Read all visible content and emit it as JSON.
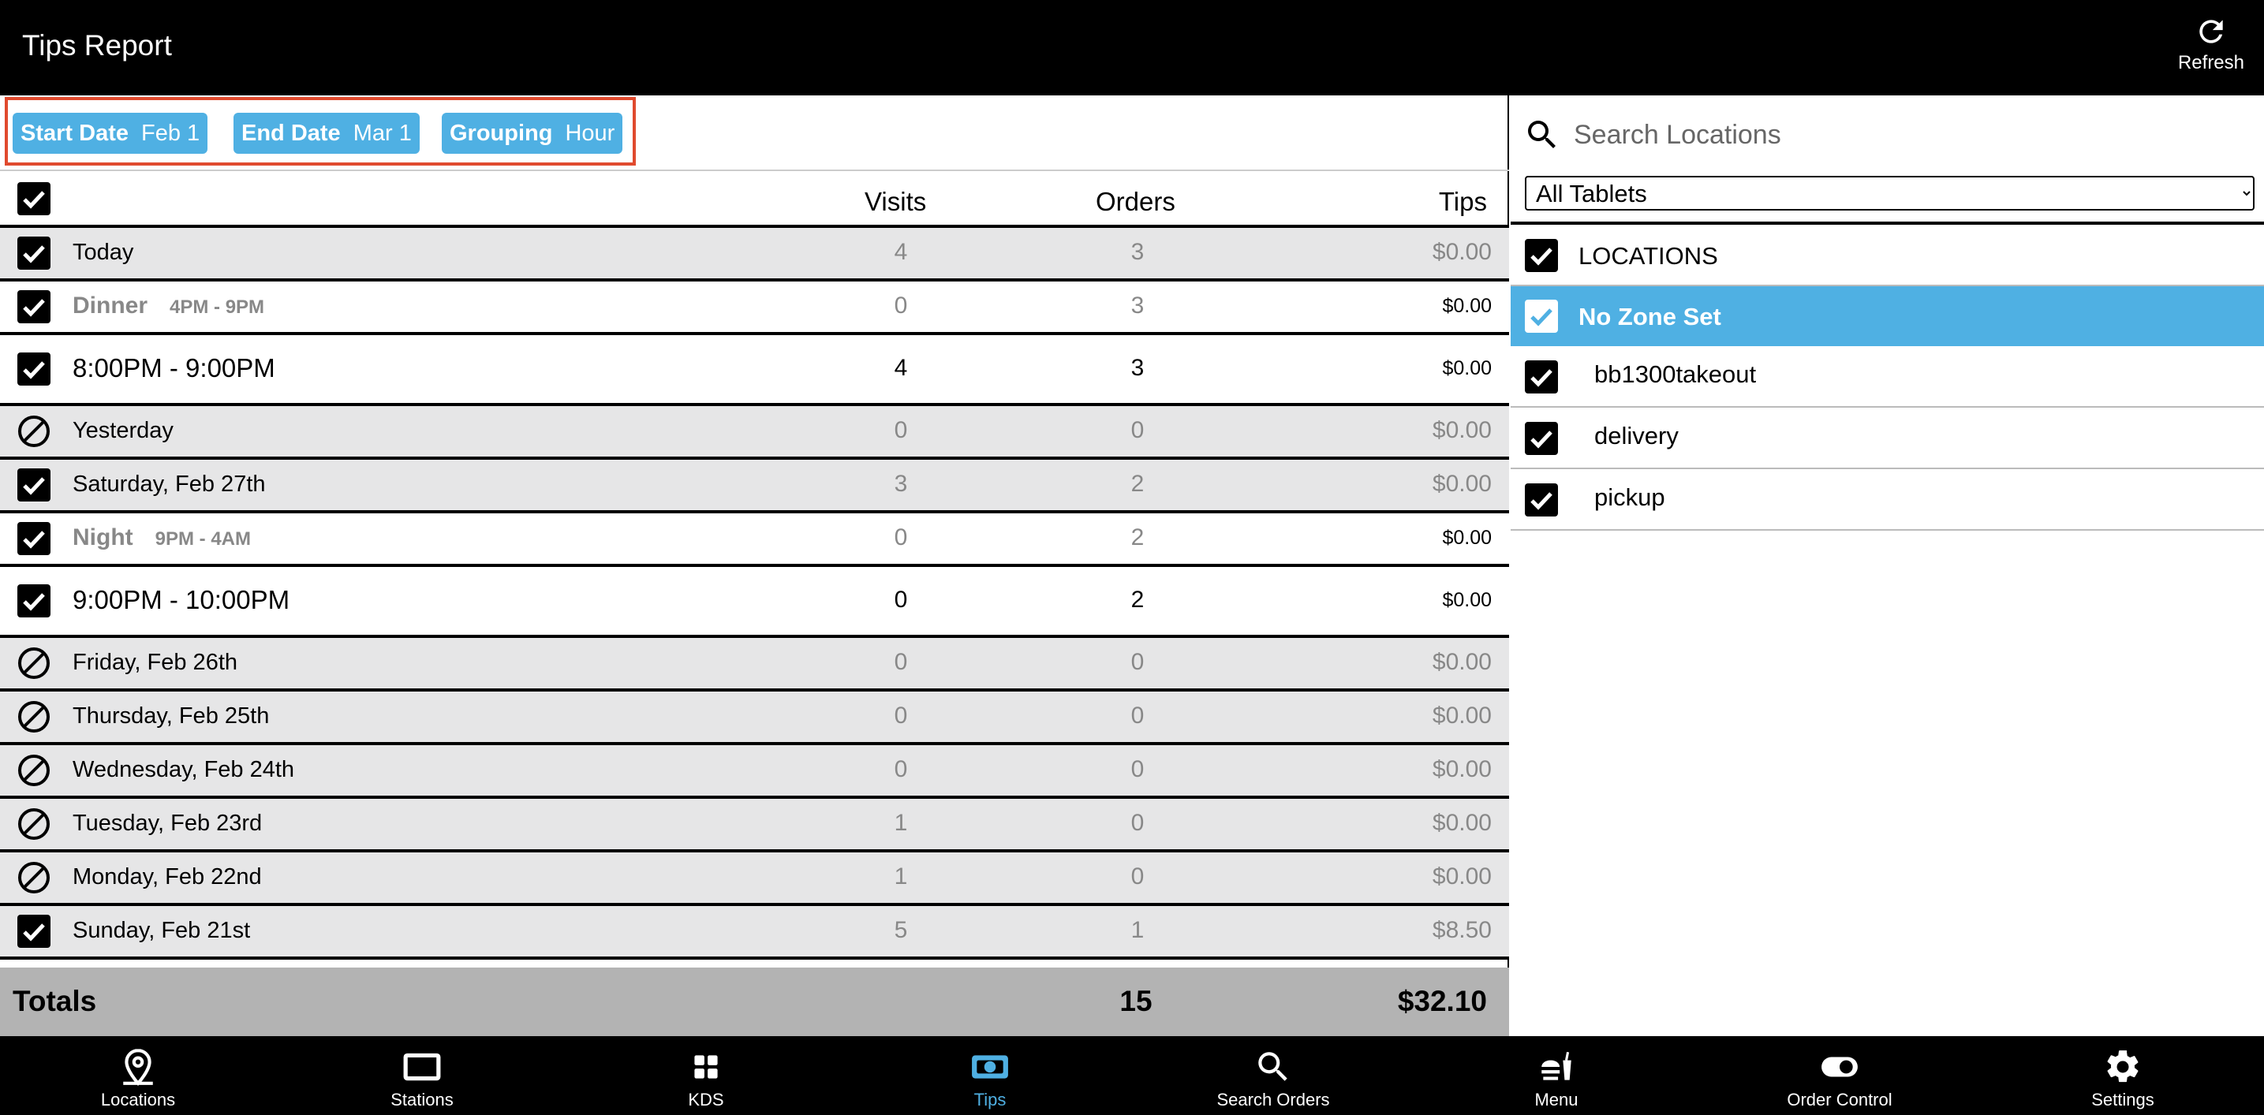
{
  "header": {
    "title": "Tips Report",
    "refresh_label": "Refresh",
    "refresh_icon": "refresh-icon"
  },
  "filters": {
    "start_date": {
      "label": "Start Date",
      "value": "Feb 1"
    },
    "end_date": {
      "label": "End Date",
      "value": "Mar 1"
    },
    "grouping": {
      "label": "Grouping",
      "value": "Hour"
    }
  },
  "table": {
    "columns": {
      "visits": "Visits",
      "orders": "Orders",
      "tips": "Tips"
    },
    "rows": [
      {
        "label": "Today",
        "sub": "",
        "visits": "4",
        "orders": "3",
        "tips": "$0.00",
        "check": "checked",
        "style": "day"
      },
      {
        "label": "Dinner",
        "sub": "4PM - 9PM",
        "visits": "0",
        "orders": "3",
        "tips": "$0.00",
        "check": "checked",
        "style": "period"
      },
      {
        "label": "8:00PM - 9:00PM",
        "sub": "",
        "visits": "4",
        "orders": "3",
        "tips": "$0.00",
        "check": "checked",
        "style": "hour"
      },
      {
        "label": "Yesterday",
        "sub": "",
        "visits": "0",
        "orders": "0",
        "tips": "$0.00",
        "check": "disabled",
        "style": "day"
      },
      {
        "label": "Saturday, Feb 27th",
        "sub": "",
        "visits": "3",
        "orders": "2",
        "tips": "$0.00",
        "check": "checked",
        "style": "day"
      },
      {
        "label": "Night",
        "sub": "9PM - 4AM",
        "visits": "0",
        "orders": "2",
        "tips": "$0.00",
        "check": "checked",
        "style": "period"
      },
      {
        "label": "9:00PM - 10:00PM",
        "sub": "",
        "visits": "0",
        "orders": "2",
        "tips": "$0.00",
        "check": "checked",
        "style": "hour"
      },
      {
        "label": "Friday, Feb 26th",
        "sub": "",
        "visits": "0",
        "orders": "0",
        "tips": "$0.00",
        "check": "disabled",
        "style": "day"
      },
      {
        "label": "Thursday, Feb 25th",
        "sub": "",
        "visits": "0",
        "orders": "0",
        "tips": "$0.00",
        "check": "disabled",
        "style": "day"
      },
      {
        "label": "Wednesday, Feb 24th",
        "sub": "",
        "visits": "0",
        "orders": "0",
        "tips": "$0.00",
        "check": "disabled",
        "style": "day"
      },
      {
        "label": "Tuesday, Feb 23rd",
        "sub": "",
        "visits": "1",
        "orders": "0",
        "tips": "$0.00",
        "check": "disabled",
        "style": "day"
      },
      {
        "label": "Monday, Feb 22nd",
        "sub": "",
        "visits": "1",
        "orders": "0",
        "tips": "$0.00",
        "check": "disabled",
        "style": "day"
      },
      {
        "label": "Sunday, Feb 21st",
        "sub": "",
        "visits": "5",
        "orders": "1",
        "tips": "$8.50",
        "check": "checked",
        "style": "day"
      }
    ],
    "totals": {
      "label": "Totals",
      "orders": "15",
      "tips": "$32.10"
    }
  },
  "locations": {
    "search_placeholder": "Search Locations",
    "tablet_filter": "All Tablets",
    "header_label": "LOCATIONS",
    "zone_label": "No Zone Set",
    "items": [
      "bb1300takeout",
      "delivery",
      "pickup"
    ]
  },
  "nav": [
    {
      "label": "Locations",
      "icon": "map-pin-icon",
      "active": false
    },
    {
      "label": "Stations",
      "icon": "tablet-icon",
      "active": false
    },
    {
      "label": "KDS",
      "icon": "grid-icon",
      "active": false
    },
    {
      "label": "Tips",
      "icon": "money-icon",
      "active": true
    },
    {
      "label": "Search Orders",
      "icon": "search-icon",
      "active": false
    },
    {
      "label": "Menu",
      "icon": "food-icon",
      "active": false
    },
    {
      "label": "Order Control",
      "icon": "toggle-icon",
      "active": false
    },
    {
      "label": "Settings",
      "icon": "gear-icon",
      "active": false
    }
  ],
  "colors": {
    "accent": "#4fb0e3",
    "highlight_border": "#e04a2e",
    "grey_row": "#e6e6e7",
    "totals_bg": "#b3b3b3"
  }
}
